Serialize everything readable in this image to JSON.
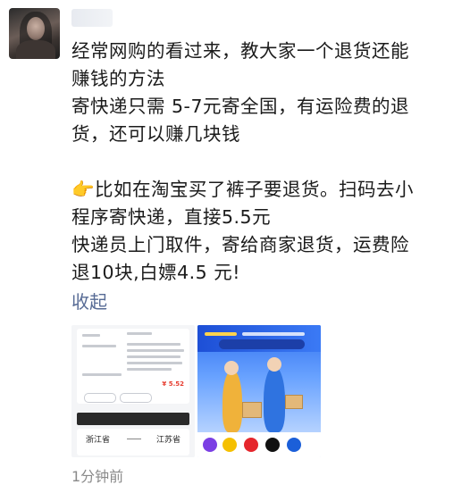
{
  "post": {
    "lines": [
      "经常网购的看过来，教大家一个退货还能",
      "赚钱的方法",
      "寄快递只需 5-7元寄全国，有运险费的退",
      "货，还可以赚几块钱",
      "",
      "👉比如在淘宝买了裤子要退货。扫码去小",
      "程序寄快递，直接5.5元",
      "快递员上门取件，寄给商家退货，运费险",
      "退10块,白嫖4.5 元!"
    ],
    "collapse_label": "收起",
    "timestamp": "1分钟前"
  },
  "thumbnail1": {
    "price": "¥ 5.52",
    "from": "浙江省",
    "to": "江苏省"
  },
  "colors": {
    "link": "#576b95",
    "price": "#e63b2e",
    "banner": "#2d6ff0"
  },
  "icons": [
    "avatar",
    "more-dots-icon"
  ]
}
